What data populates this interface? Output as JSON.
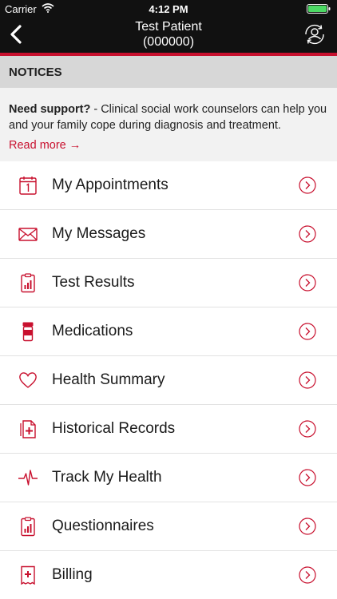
{
  "status": {
    "carrier": "Carrier",
    "time": "4:12 PM"
  },
  "header": {
    "patient_name": "Test Patient",
    "patient_id": "(000000)"
  },
  "notices": {
    "heading": "NOTICES",
    "title": "Need support?",
    "body": " - Clinical social work counselors can help you and your family cope during diagnosis and treatment.",
    "read_more": "Read more →"
  },
  "menu": [
    {
      "label": "My Appointments",
      "icon": "calendar-icon"
    },
    {
      "label": "My Messages",
      "icon": "envelope-icon"
    },
    {
      "label": "Test Results",
      "icon": "clipboard-chart-icon"
    },
    {
      "label": "Medications",
      "icon": "pill-bottle-icon"
    },
    {
      "label": "Health Summary",
      "icon": "heart-icon"
    },
    {
      "label": "Historical Records",
      "icon": "medical-records-icon"
    },
    {
      "label": "Track My Health",
      "icon": "heartbeat-icon"
    },
    {
      "label": "Questionnaires",
      "icon": "clipboard-chart-icon"
    },
    {
      "label": "Billing",
      "icon": "bill-icon"
    }
  ],
  "colors": {
    "accent": "#c8102e",
    "header_bg": "#111111",
    "notice_bg": "#f2f2f2",
    "section_bg": "#d7d7d7"
  }
}
